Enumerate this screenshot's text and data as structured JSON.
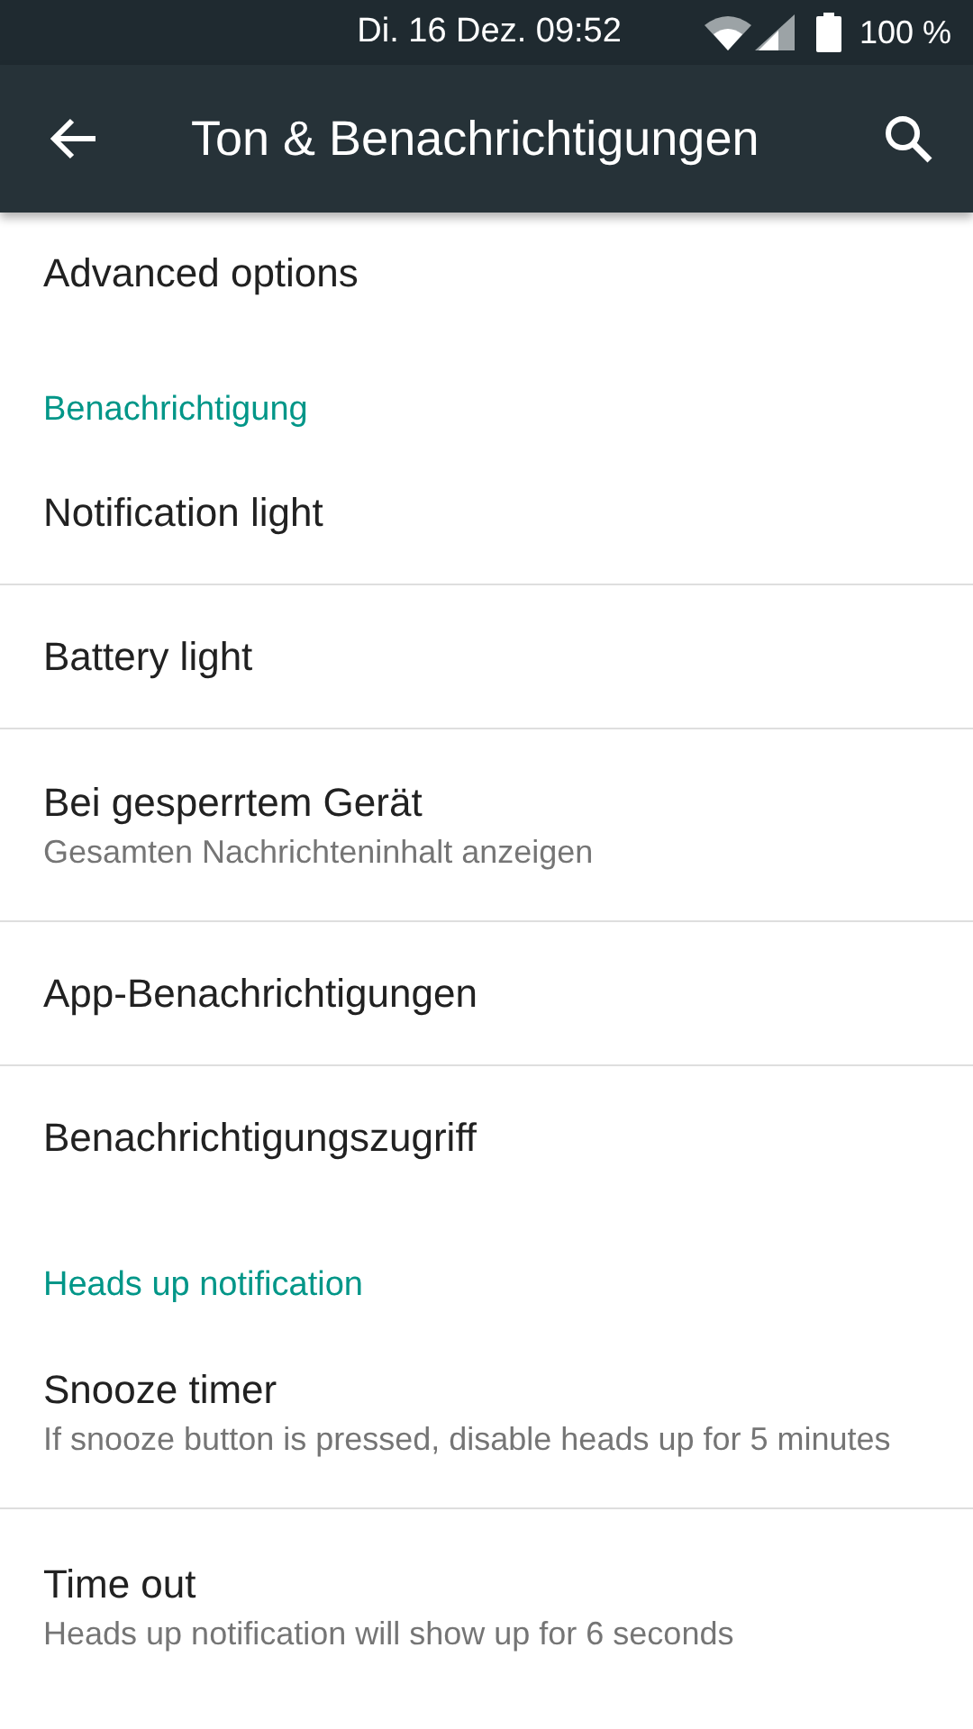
{
  "status_bar": {
    "datetime": "Di. 16 Dez. 09:52",
    "battery": "100 %"
  },
  "toolbar": {
    "title": "Ton & Benachrichtigungen"
  },
  "list": [
    {
      "kind": "item",
      "title": "Advanced options"
    },
    {
      "kind": "header",
      "title": "Benachrichtigung"
    },
    {
      "kind": "item",
      "title": "Notification light"
    },
    {
      "kind": "item",
      "title": "Battery light"
    },
    {
      "kind": "item",
      "title": "Bei gesperrtem Gerät",
      "summary": "Gesamten Nachrichteninhalt anzeigen"
    },
    {
      "kind": "item",
      "title": "App-Benachrichtigungen"
    },
    {
      "kind": "item",
      "title": "Benachrichtigungszugriff"
    },
    {
      "kind": "header",
      "title": "Heads up notification"
    },
    {
      "kind": "item",
      "title": "Snooze timer",
      "summary": "If snooze button is pressed, disable heads up for 5 minutes"
    },
    {
      "kind": "item",
      "title": "Time out",
      "summary": "Heads up notification will show up for 6 seconds"
    }
  ]
}
